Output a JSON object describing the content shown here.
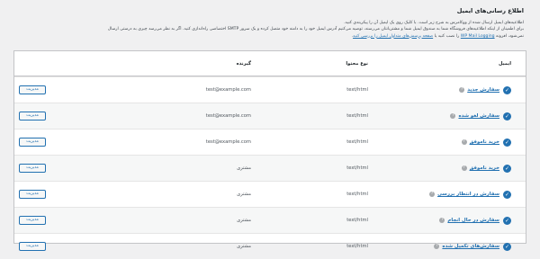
{
  "section_title": "اطلاع رسانی‌های ایمیل",
  "description": {
    "line1": "اطلاعیه‌های ایمیل ارسال شده از ووکامرس به شرح زیر است. با کلیک روی یک ایمیل آن را پیکربندی کنید.",
    "line2": "برای اطمینان از اینکه اطلاعیه‌های فروشگاه شما به صندوق ایمیل شما و مشتریانتان می‌رسند، توصیه می‌کنیم آدرس ایمیل خود را به دامنه خود متصل کرده و یک سرور SMTP اختصاصی راه‌اندازی کنید. اگر به نظر می‌رسد چیزی به درستی ارسال",
    "line3_pre": "نمی‌شود، افزونه",
    "line3_plugin": "WP Mail Logging",
    "line3_mid": "را نصب کنید یا",
    "line3_link": "صفحه پرسش‌های متداول ایمیل را بررسی کنید",
    "line3_post": "."
  },
  "table": {
    "headers": {
      "email": "ایمیل",
      "content_type": "نوع محتوا",
      "recipient": "گیرنده"
    },
    "rows": [
      {
        "name": "سفارش جدید",
        "content_type": "text/html",
        "recipient": "test@example.com",
        "action": "مدیریت",
        "status": "enabled"
      },
      {
        "name": "سفارش لغو شده",
        "content_type": "text/html",
        "recipient": "test@example.com",
        "action": "مدیریت",
        "status": "enabled"
      },
      {
        "name": "خرید ناموفق",
        "content_type": "text/html",
        "recipient": "test@example.com",
        "action": "مدیریت",
        "status": "enabled"
      },
      {
        "name": "خرید ناموفق",
        "content_type": "text/html",
        "recipient": "مشتری",
        "action": "مدیریت",
        "status": "enabled"
      },
      {
        "name": "سفارش در انتظار بررسی",
        "content_type": "text/html",
        "recipient": "مشتری",
        "action": "مدیریت",
        "status": "enabled"
      },
      {
        "name": "سفارش در حال انجام",
        "content_type": "text/html",
        "recipient": "مشتری",
        "action": "مدیریت",
        "status": "enabled"
      },
      {
        "name": "سفارش‌های تکمیل شده",
        "content_type": "text/html",
        "recipient": "مشتری",
        "action": "مدیریت",
        "status": "enabled"
      }
    ]
  },
  "colors": {
    "accent": "#2271b1",
    "background": "#f0f0f1",
    "border": "#c3c4c7"
  },
  "icons": {
    "status": "check-circle-icon",
    "help": "help-icon"
  }
}
